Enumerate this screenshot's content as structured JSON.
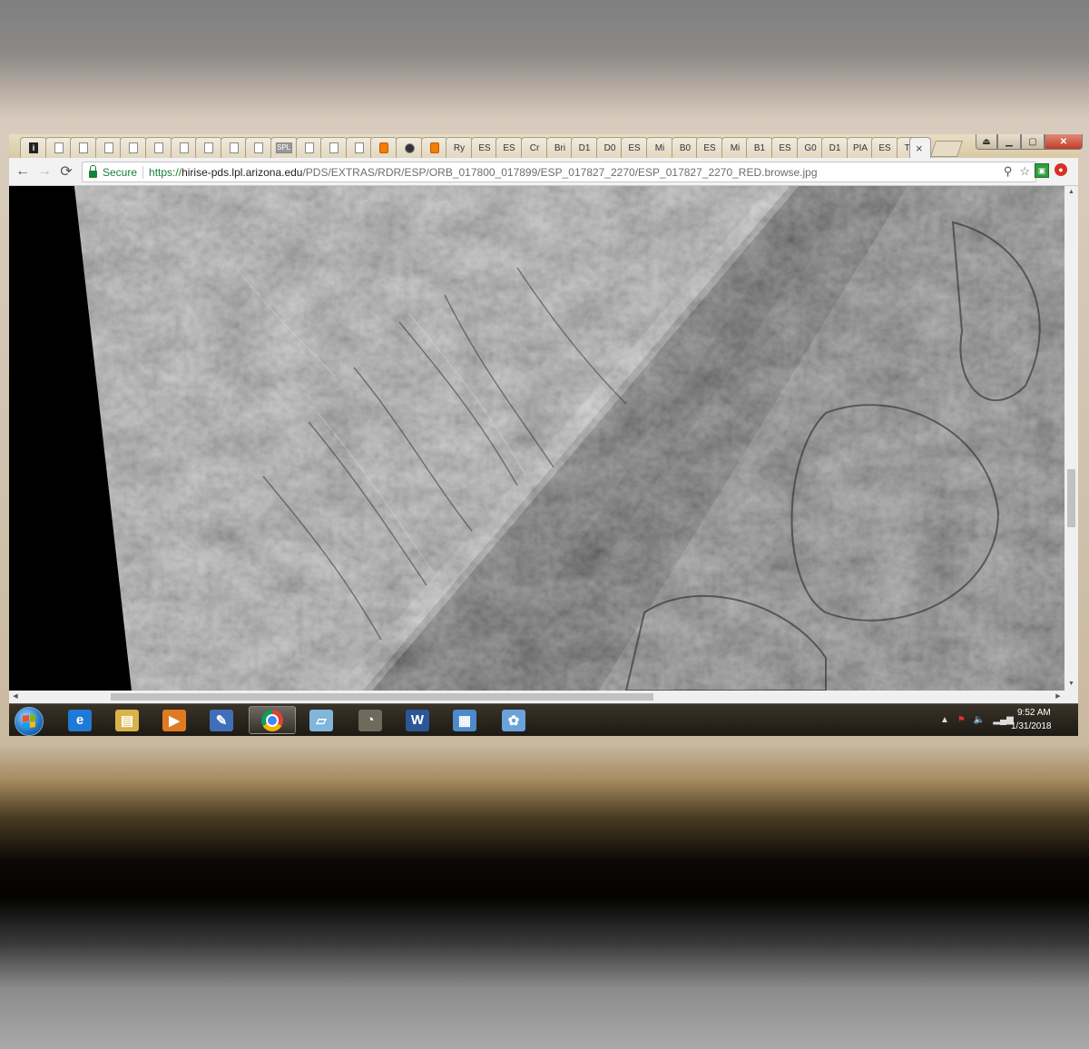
{
  "browser": {
    "tabs": [
      {
        "label": "",
        "favicon": "info-icon"
      },
      {
        "label": "",
        "favicon": "page-icon"
      },
      {
        "label": "",
        "favicon": "page-icon"
      },
      {
        "label": "",
        "favicon": "page-icon"
      },
      {
        "label": "",
        "favicon": "page-icon"
      },
      {
        "label": "",
        "favicon": "page-icon"
      },
      {
        "label": "",
        "favicon": "page-icon"
      },
      {
        "label": "",
        "favicon": "page-icon"
      },
      {
        "label": "",
        "favicon": "page-icon"
      },
      {
        "label": "",
        "favicon": "page-icon"
      },
      {
        "label": "SPL",
        "favicon": "site-icon"
      },
      {
        "label": "",
        "favicon": "page-icon"
      },
      {
        "label": "",
        "favicon": "page-icon"
      },
      {
        "label": "",
        "favicon": "page-icon"
      },
      {
        "label": "",
        "favicon": "blogger-icon"
      },
      {
        "label": "",
        "favicon": "dark-circle-icon"
      },
      {
        "label": "",
        "favicon": "blogger-icon"
      },
      {
        "label": "Ry",
        "favicon": ""
      },
      {
        "label": "ES",
        "favicon": ""
      },
      {
        "label": "ES",
        "favicon": ""
      },
      {
        "label": "Cr",
        "favicon": ""
      },
      {
        "label": "Bri",
        "favicon": ""
      },
      {
        "label": "D1",
        "favicon": ""
      },
      {
        "label": "D0",
        "favicon": ""
      },
      {
        "label": "ES",
        "favicon": ""
      },
      {
        "label": "Mi",
        "favicon": ""
      },
      {
        "label": "B0",
        "favicon": ""
      },
      {
        "label": "ES",
        "favicon": ""
      },
      {
        "label": "Mi",
        "favicon": ""
      },
      {
        "label": "B1",
        "favicon": ""
      },
      {
        "label": "ES",
        "favicon": ""
      },
      {
        "label": "G0",
        "favicon": ""
      },
      {
        "label": "D1",
        "favicon": ""
      },
      {
        "label": "PIA",
        "favicon": ""
      },
      {
        "label": "ES",
        "favicon": ""
      },
      {
        "label": "Tw",
        "favicon": ""
      }
    ],
    "active_tab_close": "×",
    "window_controls": {
      "minimize": "▁",
      "maximize": "▢",
      "close": "✕",
      "user": "⏏"
    },
    "nav": {
      "back": "←",
      "forward": "→",
      "reload": "⟳"
    },
    "omnibox": {
      "secure_label": "Secure",
      "url_scheme": "https://",
      "url_host": "hirise-pds.lpl.arizona.edu",
      "url_path": "/PDS/EXTRAS/RDR/ESP/ORB_017800_017899/ESP_017827_2270/ESP_017827_2270_RED.browse.jpg",
      "zoom_icon": "⚲",
      "star_icon": "☆"
    },
    "extensions": [
      {
        "icon": "shield-extension-icon",
        "glyph": "▣"
      },
      {
        "icon": "red-extension-icon",
        "glyph": "●"
      }
    ]
  },
  "content": {
    "image_description_icon": "mars-terrain-image"
  },
  "scrollbars": {
    "up": "▲",
    "down": "▼",
    "left": "◀",
    "right": "▶"
  },
  "taskbar": {
    "apps": [
      {
        "name": "internet-explorer",
        "glyph": "e",
        "color": "#1e7ad6"
      },
      {
        "name": "file-explorer",
        "glyph": "▤",
        "color": "#d9b24a"
      },
      {
        "name": "media-player",
        "glyph": "▶",
        "color": "#e07b22"
      },
      {
        "name": "network-tool",
        "glyph": "✎",
        "color": "#3f6fb8"
      },
      {
        "name": "chrome",
        "glyph": "",
        "color": "#dd4b39"
      },
      {
        "name": "notepad",
        "glyph": "▱",
        "color": "#7fb6d9"
      },
      {
        "name": "gimp",
        "glyph": "◔",
        "color": "#6e6a5c"
      },
      {
        "name": "word",
        "glyph": "W",
        "color": "#2b5797"
      },
      {
        "name": "photo-viewer",
        "glyph": "▦",
        "color": "#4e89c9"
      },
      {
        "name": "paint",
        "glyph": "✿",
        "color": "#6aa3d9"
      }
    ],
    "tray": {
      "show_hidden": "▲",
      "time": "9:52 AM",
      "date": "1/31/2018"
    }
  }
}
